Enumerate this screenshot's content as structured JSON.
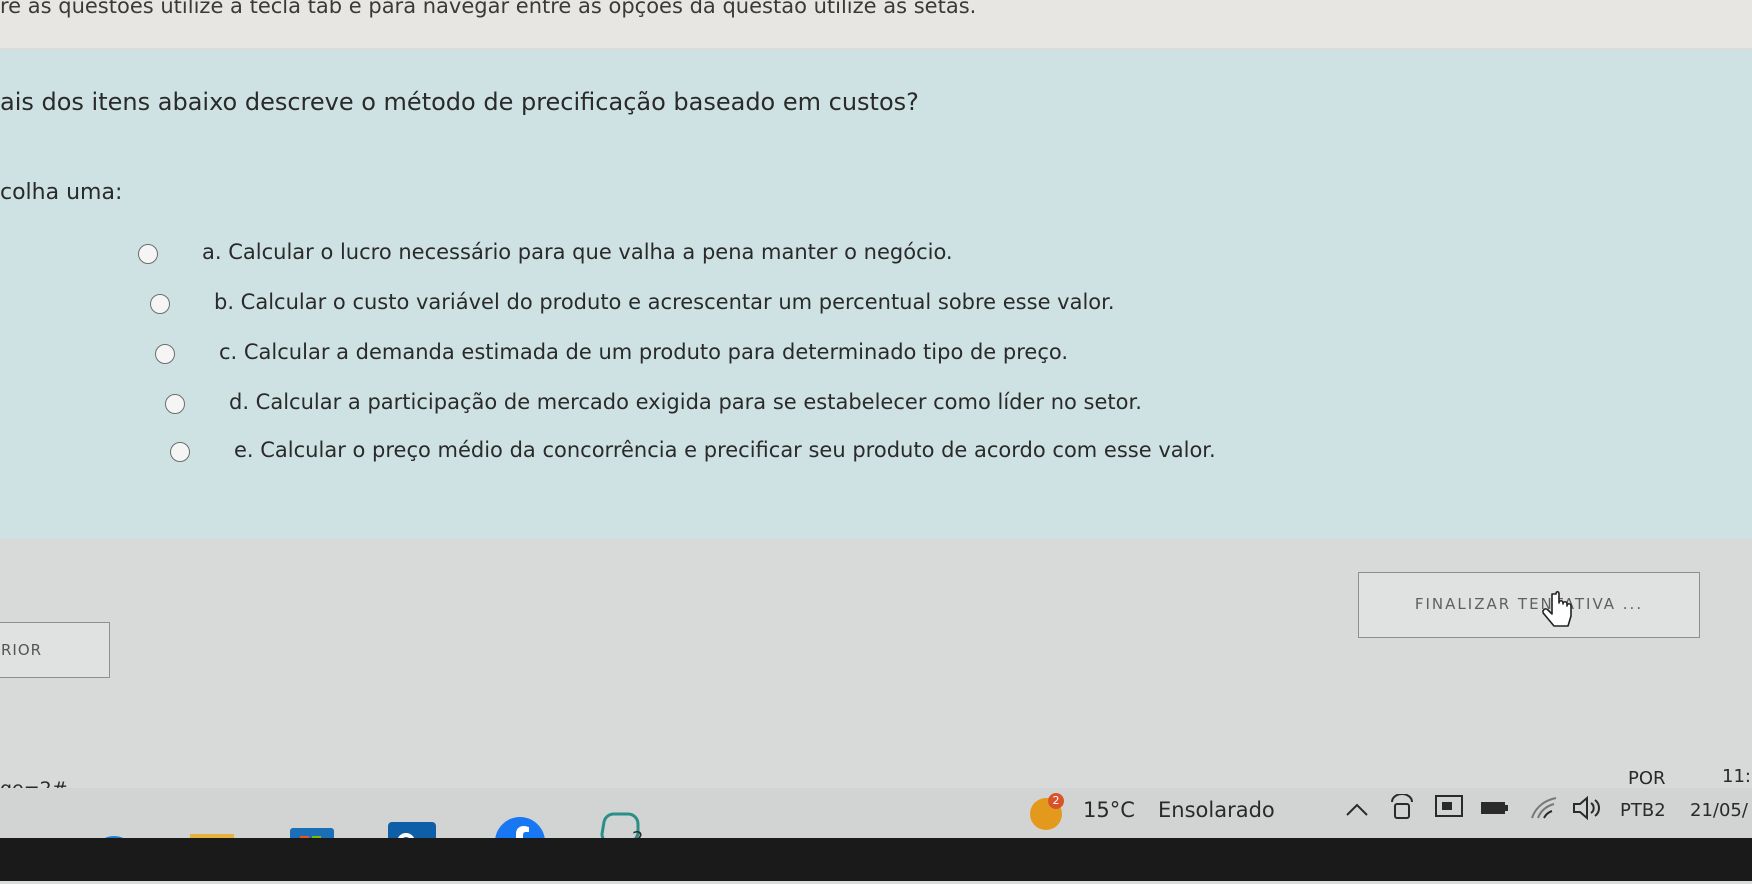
{
  "instructions": {
    "hint": "re as questões utilize a tecla tab e para navegar entre as opções da questão utilize as setas."
  },
  "question": {
    "text": "ais dos itens abaixo descreve o método de precificação baseado em custos?",
    "choose_label": "colha uma:",
    "options": [
      {
        "label": "a. Calcular o lucro necessário para que valha a pena manter o negócio.",
        "selected": false
      },
      {
        "label": "b. Calcular o custo variável do produto e acrescentar um percentual sobre esse valor.",
        "selected": false
      },
      {
        "label": "c. Calcular a demanda estimada de um produto para determinado tipo de preço.",
        "selected": false
      },
      {
        "label": "d. Calcular a participação de mercado exigida para se estabelecer como líder no setor.",
        "selected": false
      },
      {
        "label": "e. Calcular o preço médio da concorrência e precificar seu produto de acordo com esse valor.",
        "selected": false
      }
    ]
  },
  "navigation": {
    "previous_label": "RIOR",
    "finish_label": "FINALIZAR TENTATIVA ..."
  },
  "url_fragment": "ge=2#",
  "taskbar": {
    "chat_badge": "2",
    "weather_badge": "2",
    "temperature": "15°C",
    "weather": "Ensolarado",
    "language": "POR",
    "keyboard": "PTB2",
    "time": "11:",
    "date": "21/05/"
  },
  "colors": {
    "question_panel": "#cfe2e3",
    "background": "#d9dcda",
    "edge_blue": "#1b7fd6",
    "weather_sun": "#e39a1c"
  }
}
